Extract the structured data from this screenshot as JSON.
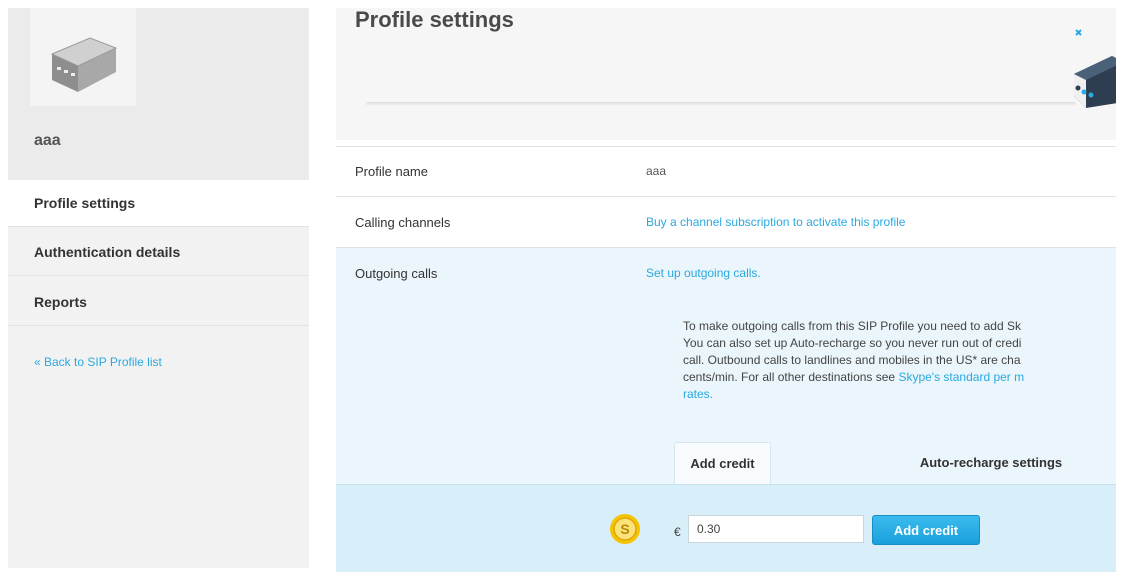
{
  "sidebar": {
    "profile_name": "aaa",
    "nav": [
      {
        "label": "Profile settings",
        "active": true
      },
      {
        "label": "Authentication details",
        "active": false
      },
      {
        "label": "Reports",
        "active": false
      }
    ],
    "back_link": "« Back to SIP Profile list"
  },
  "main": {
    "title": "Profile settings",
    "rows": {
      "profile_name": {
        "label": "Profile name",
        "value": "aaa"
      },
      "calling_channels": {
        "label": "Calling channels",
        "link": "Buy a channel subscription to activate this profile"
      },
      "outgoing_calls": {
        "label": "Outgoing calls",
        "link": "Set up outgoing calls."
      }
    },
    "description": {
      "line1": "To make outgoing calls from this SIP Profile you need to add Sk",
      "line2": "You can also set up Auto-recharge so you never run out of credi",
      "line3": "call. Outbound calls to landlines and mobiles in the US* are cha",
      "line4_text": "cents/min. For all other destinations see ",
      "line4_link": "Skype's standard per m",
      "line5_link": "rates."
    },
    "tabs": {
      "add_credit": "Add credit",
      "auto_recharge": "Auto-recharge settings"
    },
    "credit": {
      "currency": "€",
      "amount": "0.30",
      "button": "Add credit"
    }
  },
  "colors": {
    "accent": "#2aa9e0",
    "button": "#1a9fdc",
    "highlight_row": "#eaf6fb",
    "credit_panel": "#d8eef8"
  },
  "icons": {
    "avatar": "sip-device-icon",
    "header": "device-illustration",
    "coin": "skype-credit-coin-icon"
  }
}
